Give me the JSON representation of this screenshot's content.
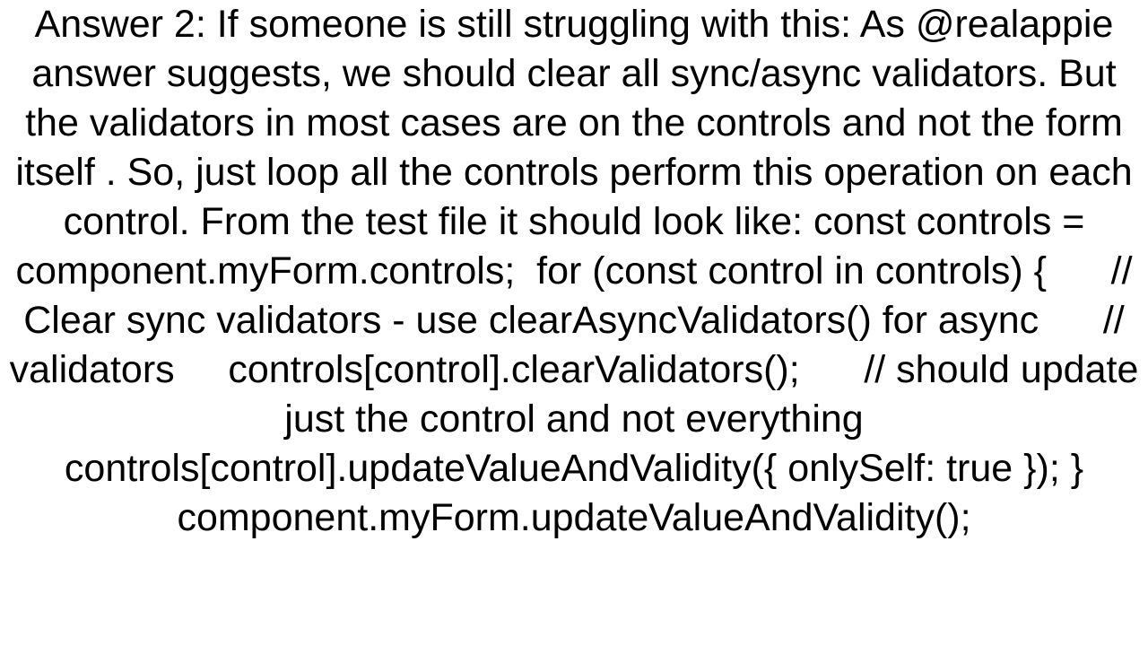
{
  "answer": {
    "text": "Answer 2: If someone is still struggling with this: As @realappie answer suggests, we should clear all sync/async validators. But the validators in most cases are on the controls and not the form itself . So, just loop all the controls perform this operation on each control. From the test file it should look like: const controls = component.myForm.controls;  for (const control in controls) {      // Clear sync validators - use clearAsyncValidators() for async      // validators     controls[control].clearValidators();      // should update just the control and not everything     controls[control].updateValueAndValidity({ onlySelf: true }); } component.myForm.updateValueAndValidity();"
  }
}
